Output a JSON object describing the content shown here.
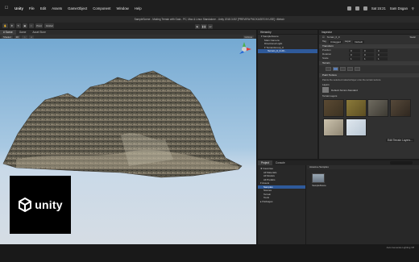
{
  "menubar": {
    "app": "Unity",
    "items": [
      "File",
      "Edit",
      "Assets",
      "GameObject",
      "Component",
      "Window",
      "Help"
    ],
    "clock": "Sat 15:21",
    "user": "Sam Dogan"
  },
  "window": {
    "title": "SampleScene - Making Terrain with Gaia - PC, Mac & Linux Standalone - Unity 2018.3.0f2 [PREVIEW PACKAGES IN USE] <Metal>"
  },
  "toolbar": {
    "pivot": "Pivot",
    "global": "Global"
  },
  "scene": {
    "tabs": [
      "# Scene",
      "Game",
      "Asset Store"
    ],
    "shading": "Shaded",
    "mode_2d": "2D",
    "gizmos": "Gizmos"
  },
  "logo": {
    "text": "unity"
  },
  "hierarchy": {
    "title": "Hierarchy",
    "rows": [
      {
        "label": "▾ SampleScene",
        "selected": false
      },
      {
        "label": "Main Camera",
        "selected": false
      },
      {
        "label": "Directional Light",
        "selected": false
      },
      {
        "label": "▾ TerrainGroup_0",
        "selected": false
      },
      {
        "label": "Terrain_0_0-20...",
        "selected": true
      }
    ]
  },
  "inspector": {
    "title": "Inspector",
    "object_name": "Terrain_0_0",
    "static": "Static",
    "tag_label": "Tag",
    "tag_value": "Untagged",
    "layer_label": "Layer",
    "layer_value": "Default",
    "transform_title": "Transform",
    "rows": [
      {
        "label": "Position",
        "x": "0",
        "y": "0",
        "z": "0"
      },
      {
        "label": "Rotation",
        "x": "0",
        "y": "0",
        "z": "0"
      },
      {
        "label": "Scale",
        "x": "1",
        "y": "1",
        "z": "1"
      }
    ],
    "terrain_title": "Terrain",
    "paint_title": "Paint Texture",
    "paint_note": "Paints the selected material layer onto the terrain texture",
    "layers_title": "Layers",
    "material_name": "Default-Terrain-Standard",
    "layers_palette_title": "Terrain Layers",
    "edit_button": "Edit Terrain Layers..."
  },
  "project": {
    "tabs": [
      "Project",
      "Console"
    ],
    "tree": [
      {
        "label": "★ Favorites",
        "selected": false
      },
      {
        "label": "All Materials",
        "selected": false
      },
      {
        "label": "All Models",
        "selected": false
      },
      {
        "label": "All Prefabs",
        "selected": false
      },
      {
        "label": "▾ Assets",
        "selected": false
      },
      {
        "label": "Samples",
        "selected": true
      },
      {
        "label": "Scenes",
        "selected": false
      },
      {
        "label": "Terrain",
        "selected": false
      },
      {
        "label": "Tools",
        "selected": false
      },
      {
        "label": "▸ Packages",
        "selected": false
      }
    ],
    "crumb": "Assets ▸ Samples",
    "asset_name": "SampleScene"
  },
  "status": {
    "right": "Auto Generate Lighting Off"
  },
  "colors": {
    "selection": "#2f5a9b",
    "editor_bg": "#282828",
    "sky": "#74a9d2"
  }
}
